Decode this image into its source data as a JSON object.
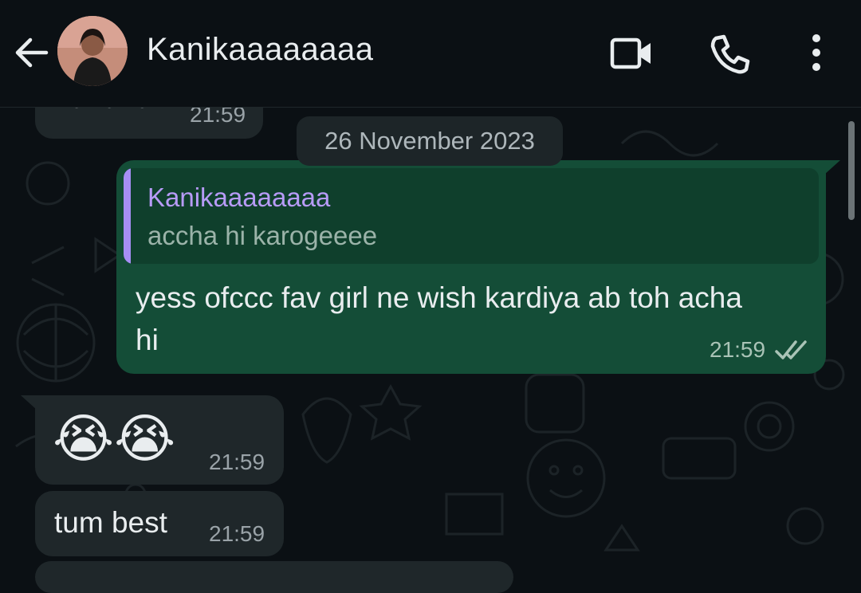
{
  "header": {
    "contact_name": "Kanikaaaaaaaa",
    "icons": [
      "back-arrow-icon",
      "video-call-icon",
      "phone-icon",
      "more-vert-icon"
    ]
  },
  "messages": {
    "partial_prev": {
      "text": "hahaha",
      "time": "21:59"
    },
    "date_divider": "26 November 2023",
    "outgoing_reply": {
      "quoted_name": "Kanikaaaaaaaa",
      "quoted_text": "accha hi karogeeee",
      "line1": "yess ofccc fav girl ne wish kardiya ab toh acha",
      "line2": "hi",
      "time": "21:59",
      "status": "read"
    },
    "emoji_msg": {
      "emojis": "😭😭",
      "time": "21:59"
    },
    "text_msg": {
      "text": "tum best",
      "time": "21:59"
    }
  },
  "colors": {
    "background": "#0b1014",
    "incoming_bubble": "#1f272a",
    "outgoing_bubble": "#144d37",
    "quote_accent": "#a78ef5",
    "read_ticks": "#a9c3b6"
  }
}
